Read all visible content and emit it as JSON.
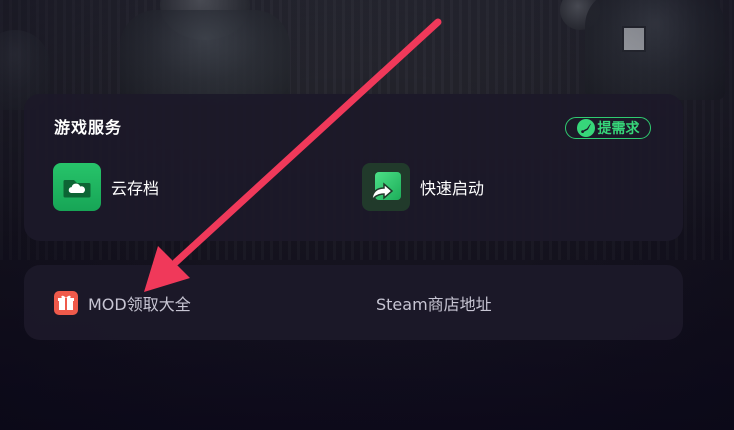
{
  "services": {
    "title": "游戏服务",
    "request_button": "提需求",
    "items": [
      {
        "label": "云存档",
        "icon": "cloud-folder-icon"
      },
      {
        "label": "快速启动",
        "icon": "quick-launch-arrow-icon"
      }
    ]
  },
  "links": {
    "items": [
      {
        "label": "MOD领取大全",
        "icon": "gift-icon"
      },
      {
        "label": "Steam商店地址"
      }
    ]
  },
  "colors": {
    "accent_green": "#37d67a",
    "card_bg": "#1c1929",
    "annotation_arrow": "#f0395a",
    "gift_red": "#ef5a4b"
  }
}
